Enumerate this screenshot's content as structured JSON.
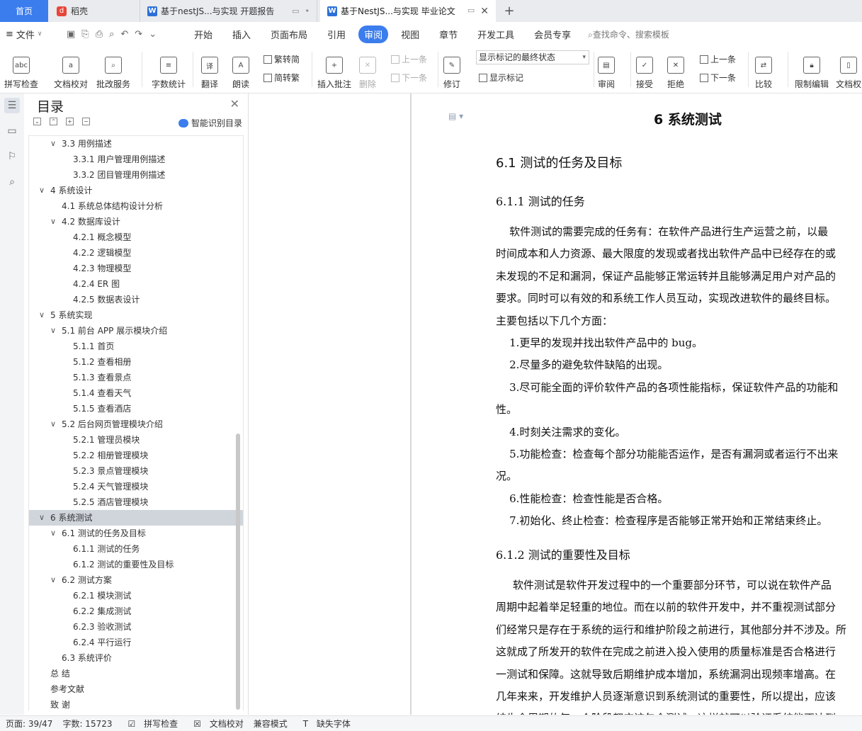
{
  "tabs": {
    "home": "首页",
    "daoke": "稻壳",
    "doc1": "基于nestJS...与实现 开题报告",
    "doc2": "基于NestJS...与实现 毕业论文"
  },
  "menu": {
    "file": "文件",
    "items": [
      "开始",
      "插入",
      "页面布局",
      "引用",
      "审阅",
      "视图",
      "章节",
      "开发工具",
      "会员专享"
    ],
    "search": "查找命令、搜索模板"
  },
  "ribbon": {
    "spellcheck": "拼写检查",
    "doc_proof": "文档校对",
    "batch_service": "批改服务",
    "word_count": "字数统计",
    "translate": "翻译",
    "read_aloud": "朗读",
    "trad_to_simp": "繁转简",
    "simp_to_trad": "简转繁",
    "insert_comment": "插入批注",
    "delete": "删除",
    "prev": "上一条",
    "next": "下一条",
    "revise": "修订",
    "markup_state": "显示标记的最终状态",
    "show_markup": "显示标记",
    "review": "审阅",
    "accept": "接受",
    "reject": "拒绝",
    "prev2": "上一条",
    "next2": "下一条",
    "compare": "比较",
    "restrict_edit": "限制编辑",
    "doc_rights": "文档权"
  },
  "toc": {
    "title": "目录",
    "ai_button": "智能识别目录",
    "items": [
      {
        "label": "3.3 用例描述",
        "level": 2,
        "chev": true
      },
      {
        "label": "3.3.1 用户管理用例描述",
        "level": 3,
        "chev": false
      },
      {
        "label": "3.3.2 团目管理用例描述",
        "level": 3,
        "chev": false
      },
      {
        "label": "4 系统设计",
        "level": 1,
        "chev": true
      },
      {
        "label": "4.1 系统总体结构设计分析",
        "level": 2,
        "chev": false
      },
      {
        "label": "4.2 数据库设计",
        "level": 2,
        "chev": true
      },
      {
        "label": "4.2.1  概念模型",
        "level": 3,
        "chev": false
      },
      {
        "label": "4.2.2  逻辑模型",
        "level": 3,
        "chev": false
      },
      {
        "label": "4.2.3  物理模型",
        "level": 3,
        "chev": false
      },
      {
        "label": "4.2.4 ER 图",
        "level": 3,
        "chev": false
      },
      {
        "label": "4.2.5  数据表设计",
        "level": 3,
        "chev": false
      },
      {
        "label": "5  系统实现",
        "level": 1,
        "chev": true
      },
      {
        "label": "5.1 前台 APP 展示模块介绍",
        "level": 2,
        "chev": true
      },
      {
        "label": "5.1.1  首页",
        "level": 3,
        "chev": false
      },
      {
        "label": "5.1.2  查看相册",
        "level": 3,
        "chev": false
      },
      {
        "label": "5.1.3  查看景点",
        "level": 3,
        "chev": false
      },
      {
        "label": "5.1.4 查看天气",
        "level": 3,
        "chev": false
      },
      {
        "label": "5.1.5 查看酒店",
        "level": 3,
        "chev": false
      },
      {
        "label": "5.2 后台网页管理模块介绍",
        "level": 2,
        "chev": true
      },
      {
        "label": "5.2.1  管理员模块",
        "level": 3,
        "chev": false
      },
      {
        "label": "5.2.2  相册管理模块",
        "level": 3,
        "chev": false
      },
      {
        "label": "5.2.3 景点管理模块",
        "level": 3,
        "chev": false
      },
      {
        "label": "5.2.4 天气管理模块",
        "level": 3,
        "chev": false
      },
      {
        "label": "5.2.5  酒店管理模块",
        "level": 3,
        "chev": false
      },
      {
        "label": "6  系统测试",
        "level": 1,
        "chev": true,
        "selected": true
      },
      {
        "label": "6.1 测试的任务及目标",
        "level": 2,
        "chev": true
      },
      {
        "label": "6.1.1 测试的任务",
        "level": 3,
        "chev": false
      },
      {
        "label": "6.1.2 测试的重要性及目标",
        "level": 3,
        "chev": false
      },
      {
        "label": "6.2 测试方案",
        "level": 2,
        "chev": true
      },
      {
        "label": "6.2.1 模块测试",
        "level": 3,
        "chev": false
      },
      {
        "label": "6.2.2 集成测试",
        "level": 3,
        "chev": false
      },
      {
        "label": "6.2.3 验收测试",
        "level": 3,
        "chev": false
      },
      {
        "label": "6.2.4 平行运行",
        "level": 3,
        "chev": false
      },
      {
        "label": "6.3 系统评价",
        "level": 2,
        "chev": false
      },
      {
        "label": "总  结",
        "level": 1,
        "chev": false
      },
      {
        "label": "参考文献",
        "level": 1,
        "chev": false
      },
      {
        "label": "致  谢",
        "level": 1,
        "chev": false
      }
    ]
  },
  "document": {
    "chapter_title": "6  系统测试",
    "h_61": "6.1 测试的任务及目标",
    "h_611": "6.1.1 测试的任务",
    "para1": [
      "    软件测试的需要完成的任务有：在软件产品进行生产运营之前，以最",
      "时间成本和人力资源、最大限度的发现或者找出软件产品中已经存在的或",
      "未发现的不足和漏洞，保证产品能够正常运转并且能够满足用户对产品的",
      "要求。同时可以有效的和系统工作人员互动，实现改进软件的最终目标。",
      "主要包括以下几个方面：",
      "    1.更早的发现并找出软件产品中的 bug。",
      "    2.尽量多的避免软件缺陷的出现。",
      "    3.尽可能全面的评价软件产品的各项性能指标，保证软件产品的功能和",
      "性。",
      "    4.时刻关注需求的变化。",
      "    5.功能检查：检查每个部分功能能否运作，是否有漏洞或者运行不出来",
      "况。",
      "    6.性能检查：检查性能是否合格。",
      "    7.初始化、终止检查：检查程序是否能够正常开始和正常结束终止。"
    ],
    "h_612": "6.1.2 测试的重要性及目标",
    "para2": [
      "     软件测试是软件开发过程中的一个重要部分环节，可以说在软件产品",
      "周期中起着举足轻重的地位。而在以前的软件开发中，并不重视测试部分",
      "们经常只是存在于系统的运行和维护阶段之前进行，其他部分并不涉及。所",
      "这就成了所发开的软件在完成之前进入投入使用的质量标准是否合格进行",
      "一测试和保障。这就导致后期维护成本增加，系统漏洞出现频率增高。在",
      "几年来来，开发维护人员逐渐意识到系统测试的重要性，所以提出，应该",
      "结生命周期的每一个阶段都应该包含测试，这样就可以验证系统能否达到"
    ]
  },
  "status": {
    "page": "页面: 39/47",
    "words": "字数: 15723",
    "spellcheck": "拼写检查",
    "doc_proof": "文档校对",
    "compat": "兼容模式",
    "missing_font": "缺失字体"
  }
}
